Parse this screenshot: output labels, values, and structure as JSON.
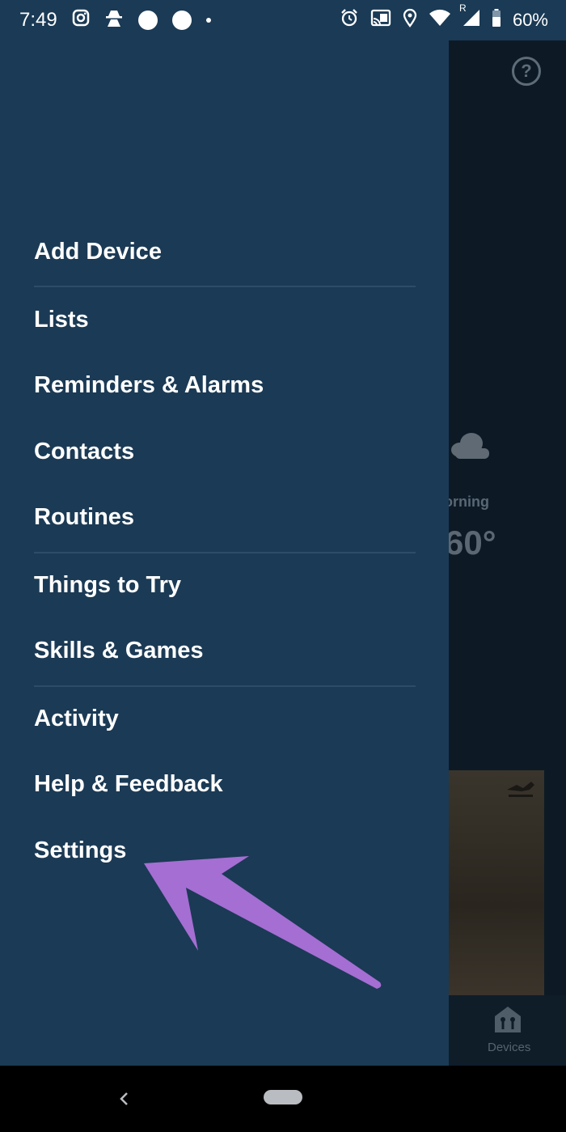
{
  "status_bar": {
    "time": "7:49",
    "battery": "60%",
    "left_icons": [
      "instagram-icon",
      "incognito-icon",
      "circle-icon",
      "circle-icon",
      "dot-icon"
    ],
    "right_icons": [
      "alarm-icon",
      "cast-icon",
      "location-icon",
      "wifi-icon",
      "signal-icon",
      "battery-icon"
    ],
    "signal_roaming": "R"
  },
  "drawer": {
    "items": [
      {
        "label": "Add Device"
      },
      {
        "label": "Lists"
      },
      {
        "label": "Reminders & Alarms"
      },
      {
        "label": "Contacts"
      },
      {
        "label": "Routines"
      },
      {
        "label": "Things to Try"
      },
      {
        "label": "Skills & Games"
      },
      {
        "label": "Activity"
      },
      {
        "label": "Help & Feedback"
      },
      {
        "label": "Settings"
      }
    ]
  },
  "background": {
    "help_symbol": "?",
    "weather_time": "orning",
    "weather_temp": "60°",
    "tab_devices_label": "Devices"
  },
  "colors": {
    "drawer_bg": "#1b3a55",
    "status_bar_bg": "#1a3a55",
    "arrow": "#a56ed3"
  }
}
